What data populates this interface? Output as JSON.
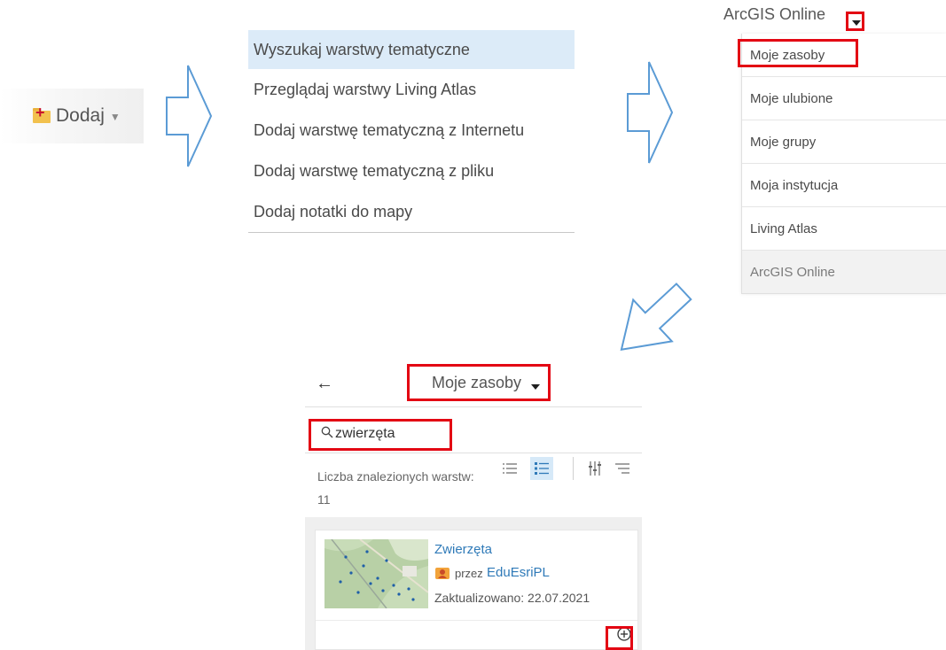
{
  "step1": {
    "button_label": "Dodaj"
  },
  "add_menu": {
    "items": [
      "Wyszukaj warstwy tematyczne",
      "Przeglądaj warstwy Living Atlas",
      "Dodaj warstwę tematyczną z Internetu",
      "Dodaj warstwę tematyczną z pliku",
      "Dodaj notatki do mapy"
    ],
    "active_index": 0
  },
  "source_dropdown": {
    "current": "ArcGIS Online",
    "items": [
      "Moje zasoby",
      "Moje ulubione",
      "Moje grupy",
      "Moja instytucja",
      "Living Atlas",
      "ArcGIS Online"
    ]
  },
  "panel": {
    "title": "Moje zasoby",
    "search_value": "zwierzęta",
    "count_label": "Liczba znalezionych warstw: 11",
    "result": {
      "title": "Zwierzęta",
      "owner_prefix": "przez",
      "owner": "EduEsriPL",
      "updated": "Zaktualizowano: 22.07.2021"
    }
  },
  "colors": {
    "highlight": "#e30613",
    "link": "#2f7ab8",
    "arrow": "#5b9bd5",
    "active_row": "#dcebf8"
  },
  "icons": [
    "plus-folder-icon",
    "caret-down-icon",
    "back-arrow-icon",
    "search-icon",
    "list-view-icon",
    "detail-view-icon",
    "filter-icon",
    "sort-icon",
    "owner-icon",
    "add-circle-icon"
  ]
}
